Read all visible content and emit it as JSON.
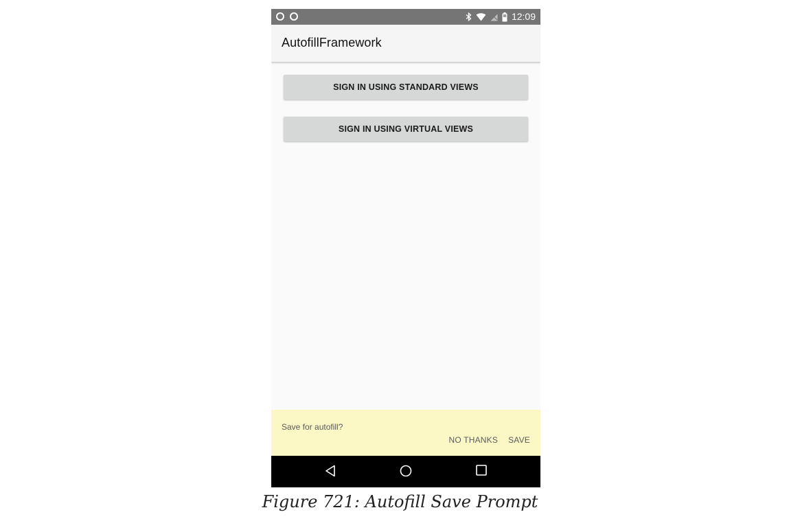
{
  "status_bar": {
    "time": "12:09",
    "left_icons": [
      "ring-icon",
      "ring-icon"
    ],
    "right_icons": [
      "bluetooth-icon",
      "wifi-icon",
      "no-sim-icon",
      "battery-icon"
    ]
  },
  "app_bar": {
    "title": "AutofillFramework"
  },
  "buttons": {
    "standard_label": "SIGN IN USING STANDARD VIEWS",
    "virtual_label": "SIGN IN USING VIRTUAL VIEWS"
  },
  "autofill_prompt": {
    "message": "Save for autofill?",
    "no_thanks_label": "NO THANKS",
    "save_label": "SAVE",
    "background_color": "#fcf8c6"
  },
  "nav_bar": {
    "icons": [
      "back-icon",
      "home-icon",
      "recents-icon"
    ]
  },
  "caption": {
    "text": "Figure 721: Autofill Save Prompt"
  }
}
